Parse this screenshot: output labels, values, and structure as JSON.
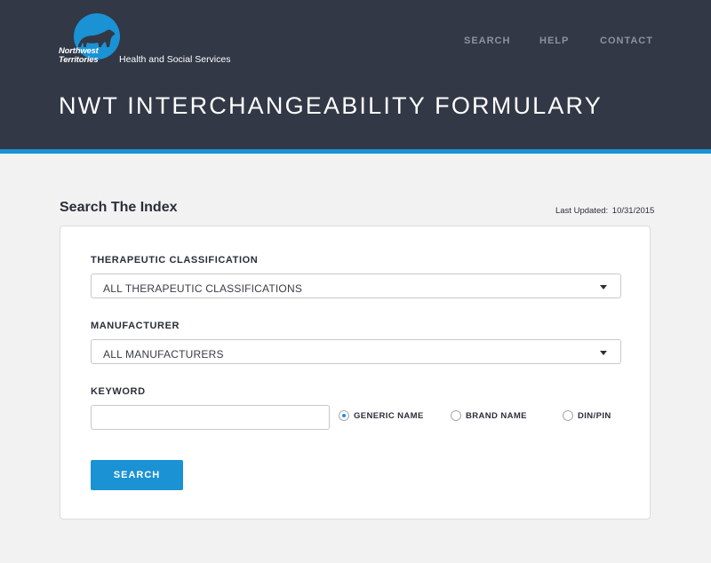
{
  "header": {
    "logo": {
      "line1": "Northwest",
      "line2": "Territories",
      "department": "Health and Social Services"
    },
    "nav": {
      "search": "SEARCH",
      "help": "HELP",
      "contact": "CONTACT"
    },
    "title": "NWT INTERCHANGEABILITY FORMULARY"
  },
  "search_section": {
    "title": "Search The Index",
    "last_updated_label": "Last Updated:",
    "last_updated_value": "10/31/2015"
  },
  "form": {
    "therapeutic": {
      "label": "THERAPEUTIC CLASSIFICATION",
      "selected": "ALL THERAPEUTIC CLASSIFICATIONS"
    },
    "manufacturer": {
      "label": "MANUFACTURER",
      "selected": "ALL MANUFACTURERS"
    },
    "keyword": {
      "label": "KEYWORD",
      "value": "",
      "placeholder": ""
    },
    "search_type": {
      "options": [
        "GENERIC NAME",
        "BRAND NAME",
        "DIN/PIN"
      ],
      "selected": "GENERIC NAME"
    },
    "submit_label": "SEARCH"
  },
  "colors": {
    "header_bg": "#323846",
    "accent": "#1a92d4",
    "page_bg": "#f2f2f2"
  }
}
